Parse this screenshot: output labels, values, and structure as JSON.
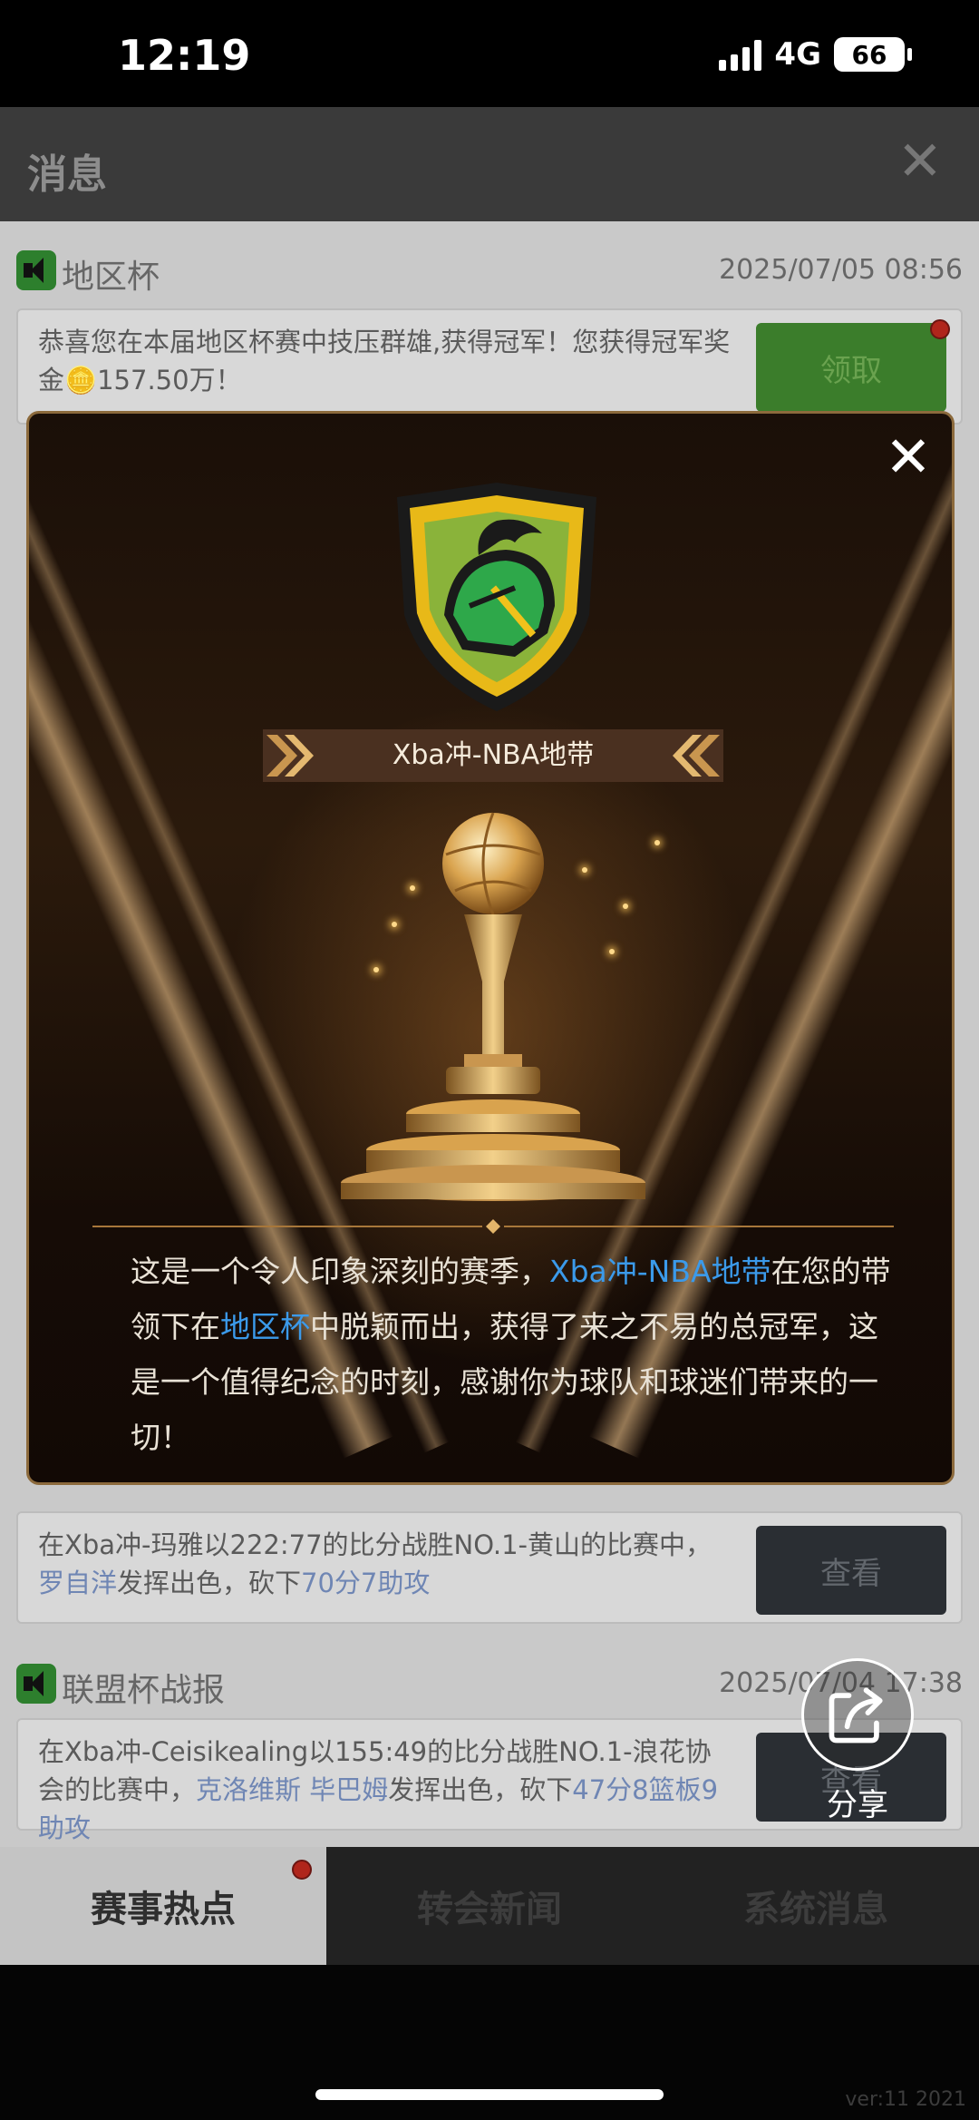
{
  "status_bar": {
    "time": "12:19",
    "network": "4G",
    "battery": "66"
  },
  "header": {
    "title": "消息",
    "close_icon": "close-icon"
  },
  "messages": [
    {
      "category": "地区杯",
      "timestamp": "2025/07/05 08:56",
      "text": "恭喜您在本届地区杯赛中技压群雄,获得冠军！您获得冠军奖金🪙157.50万！",
      "button": "领取",
      "button_style": "green",
      "has_dot": true
    },
    {
      "category": "",
      "timestamp": "",
      "text_parts": [
        "在Xba冲-玛雅以222:77的比分战胜NO.1-黄山的比赛中，",
        "罗自洋",
        "发挥出色，砍下",
        "70分7助攻"
      ],
      "button": "查看",
      "button_style": "dark"
    },
    {
      "category": "联盟杯战报",
      "timestamp": "2025/07/04 17:38",
      "text_parts": [
        "在Xba冲-Ceisikealing以155:49的比分战胜NO.1-浪花协会的比赛中，",
        "克洛维斯 毕巴姆",
        "发挥出色，砍下",
        "47分8篮板9助攻"
      ],
      "button": "查看",
      "button_style": "dark"
    }
  ],
  "tabs": [
    {
      "label": "赛事热点",
      "active": true,
      "has_dot": true
    },
    {
      "label": "转会新闻",
      "active": false
    },
    {
      "label": "系统消息",
      "active": false
    }
  ],
  "footer": {
    "version": "ver:11  2021"
  },
  "modal": {
    "team_name": "Xba冲-NBA地带",
    "body_parts": [
      "这是一个令人印象深刻的赛季，",
      "Xba冲-NBA地带",
      "在您的带领下在",
      "地区杯",
      "中脱颖而出，获得了来之不易的总冠军，这是一个值得纪念的时刻，感谢你为球队和球迷们带来的一切！"
    ],
    "close_icon": "close-icon",
    "emblem_icon": "knight-helmet-shield-icon",
    "trophy_icon": "basketball-trophy-icon"
  },
  "share": {
    "label": "分享",
    "icon": "share-icon"
  },
  "colors": {
    "highlight_blue": "#3b9aea",
    "gold": "#d8a453",
    "green_button": "#3b7d2b"
  }
}
